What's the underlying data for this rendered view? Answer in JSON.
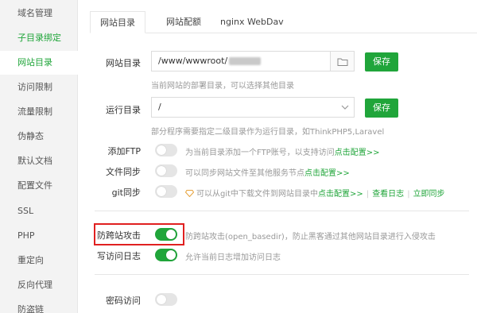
{
  "sidebar": {
    "items": [
      {
        "label": "域名管理"
      },
      {
        "label": "子目录绑定"
      },
      {
        "label": "网站目录"
      },
      {
        "label": "访问限制"
      },
      {
        "label": "流量限制"
      },
      {
        "label": "伪静态"
      },
      {
        "label": "默认文档"
      },
      {
        "label": "配置文件"
      },
      {
        "label": "SSL"
      },
      {
        "label": "PHP"
      },
      {
        "label": "重定向"
      },
      {
        "label": "反向代理"
      },
      {
        "label": "防盗链"
      }
    ]
  },
  "tabs": [
    {
      "label": "网站目录"
    },
    {
      "label": "网站配额"
    },
    {
      "label": "nginx WebDav"
    }
  ],
  "site_dir": {
    "label": "网站目录",
    "value": "/www/wwwroot/",
    "save": "保存",
    "hint": "当前网站的部署目录，可以选择其他目录"
  },
  "run_dir": {
    "label": "运行目录",
    "value": "/",
    "save": "保存",
    "hint": "部分程序需要指定二级目录作为运行目录，如ThinkPHP5,Laravel"
  },
  "ftp": {
    "label": "添加FTP",
    "desc": "为当前目录添加一个FTP账号，以支持访问",
    "link": "点击配置>>"
  },
  "filesync": {
    "label": "文件同步",
    "desc": "可以同步网站文件至其他服务节点",
    "link": "点击配置>>"
  },
  "gitsync": {
    "label": "git同步",
    "desc": "可以从git中下载文件到网站目录中",
    "link": "点击配置>>",
    "sep1": "|",
    "log": "查看日志",
    "sep2": "|",
    "sync_now": "立即同步"
  },
  "anti_xss": {
    "label": "防跨站攻击",
    "desc": "防跨站攻击(open_basedir)，防止黑客通过其他网站目录进行入侵攻击"
  },
  "access_log": {
    "label": "写访问日志",
    "desc": "允许当前日志增加访问日志"
  },
  "password": {
    "label": "密码访问"
  },
  "colors": {
    "accent": "#20a53a",
    "highlight": "#e02020"
  }
}
